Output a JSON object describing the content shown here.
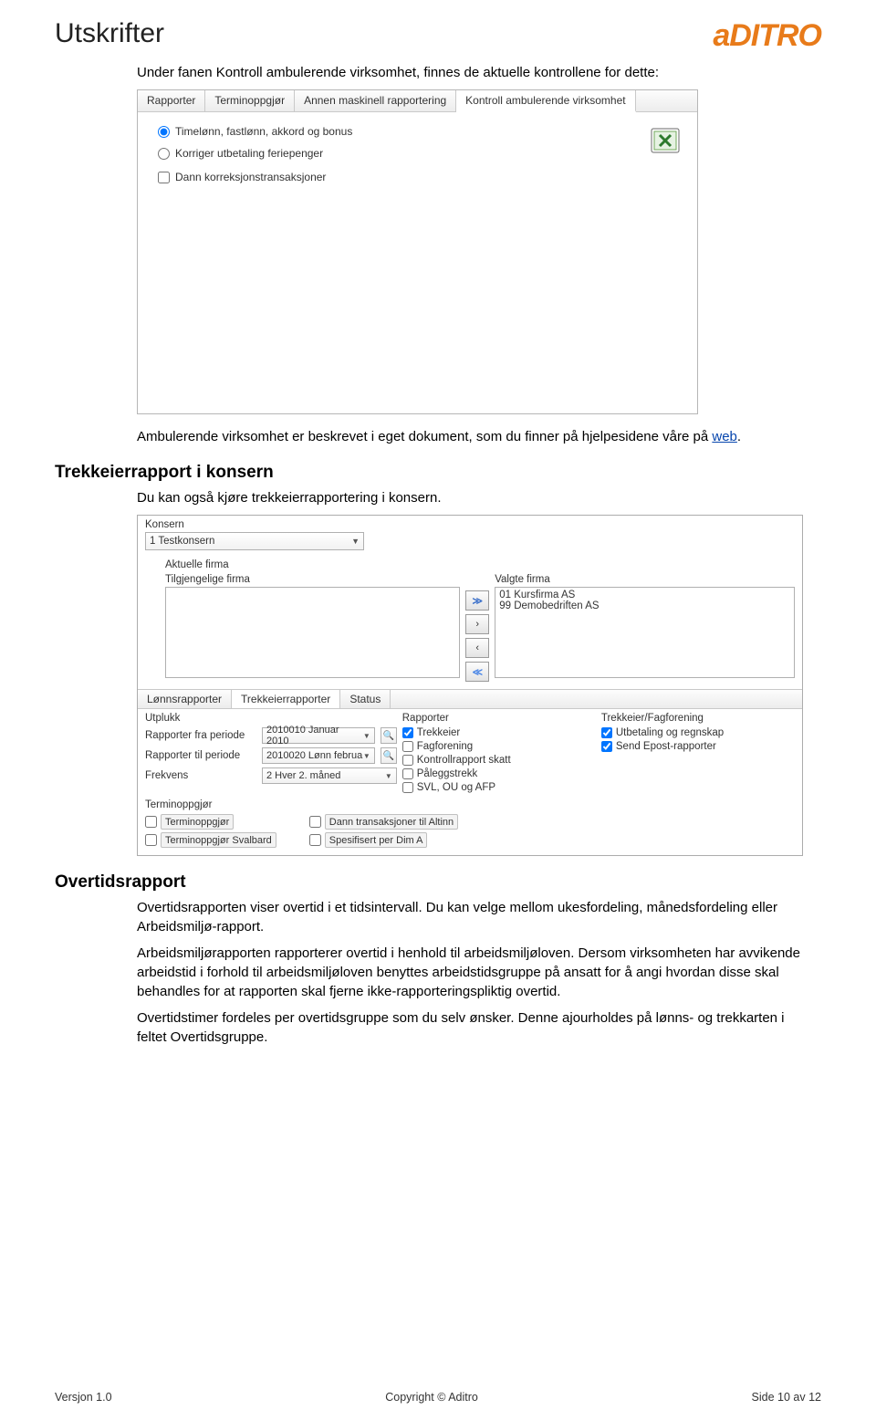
{
  "header": {
    "title": "Utskrifter",
    "brand": "aDITRO"
  },
  "intro": {
    "line1": "Under fanen Kontroll ambulerende virksomhet, finnes de aktuelle kontrollene for dette:"
  },
  "shot1": {
    "tabs": [
      "Rapporter",
      "Terminoppgjør",
      "Annen maskinell rapportering",
      "Kontroll ambulerende virksomhet"
    ],
    "activeTab": 3,
    "radio1": "Timelønn, fastlønn, akkord og bonus",
    "radio2": "Korriger utbetaling feriepenger",
    "checkbox": "Dann korreksjonstransaksjoner"
  },
  "amb_para": {
    "t1": "Ambulerende virksomhet er beskrevet i eget dokument, som du finner på hjelpesidene våre på ",
    "link": "web",
    "t2": "."
  },
  "trekk": {
    "heading": "Trekkeierrapport i konsern",
    "para": "Du kan også kjøre trekkeierrapportering i konsern."
  },
  "shot2": {
    "konsern_label": "Konsern",
    "konsern_val": "1 Testkonsern",
    "akt_firma": "Aktuelle firma",
    "tilgj": "Tilgjengelige firma",
    "valgte": "Valgte firma",
    "valgteItems": [
      "01 Kursfirma AS",
      "99 Demobedriften AS"
    ],
    "tabs": [
      "Lønnsrapporter",
      "Trekkeierrapporter",
      "Status"
    ],
    "activeTab": 1,
    "utplukk": "Utplukk",
    "rfra_l": "Rapporter fra periode",
    "rfra_v": "2010010 Januar 2010",
    "rtil_l": "Rapporter til periode",
    "rtil_v": "2010020 Lønn februa",
    "frek_l": "Frekvens",
    "frek_v": "2 Hver 2. måned",
    "rapporter_h": "Rapporter",
    "rapporter": [
      {
        "label": "Trekkeier",
        "checked": true
      },
      {
        "label": "Fagforening",
        "checked": false
      },
      {
        "label": "Kontrollrapport skatt",
        "checked": false
      },
      {
        "label": "Påleggstrekk",
        "checked": false
      },
      {
        "label": "SVL, OU og AFP",
        "checked": false
      }
    ],
    "tf_h": "Trekkeier/Fagforening",
    "tf": [
      {
        "label": "Utbetaling og regnskap",
        "checked": true
      },
      {
        "label": "Send Epost-rapporter",
        "checked": true
      }
    ],
    "term_h": "Terminoppgjør",
    "term_c1a": "Terminoppgjør",
    "term_c1b": "Terminoppgjør Svalbard",
    "term_c2a": "Dann transaksjoner til Altinn",
    "term_c2b": "Spesifisert per Dim A"
  },
  "overtid": {
    "heading": "Overtidsrapport",
    "p1": "Overtidsrapporten viser overtid i et tidsintervall. Du kan velge mellom ukesfordeling, månedsfordeling eller Arbeidsmiljø-rapport.",
    "p2": "Arbeidsmiljørapporten rapporterer overtid i henhold til arbeidsmiljøloven. Dersom virksomheten har avvikende arbeidstid i forhold til arbeidsmiljøloven benyttes arbeidstidsgruppe på ansatt for å angi hvordan disse skal behandles for at rapporten skal fjerne ikke-rapporteringspliktig overtid.",
    "p3": "Overtidstimer fordeles per overtidsgruppe som du selv ønsker. Denne ajourholdes på lønns- og trekkarten i feltet Overtidsgruppe."
  },
  "footer": {
    "left": "Versjon 1.0",
    "center": "Copyright © Aditro",
    "right": "Side 10 av 12"
  }
}
